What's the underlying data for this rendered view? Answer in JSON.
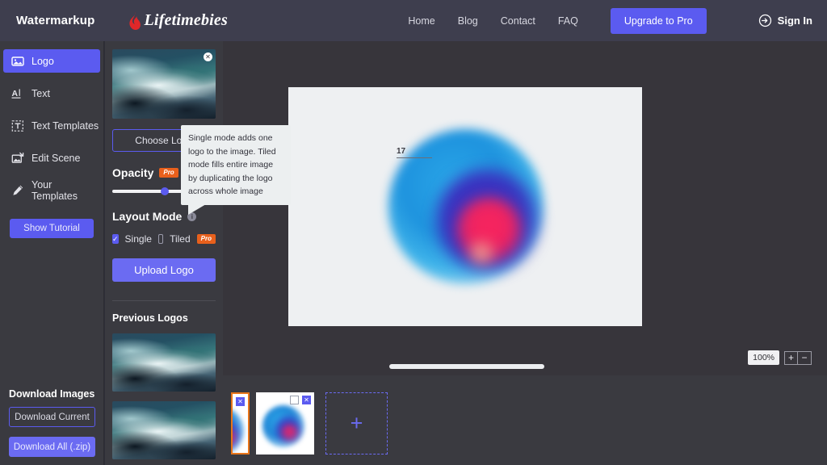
{
  "header": {
    "brand": "Watermarkup",
    "logo_word": "Lifetimebies",
    "logo_icon": "flame-icon",
    "nav": [
      {
        "label": "Home"
      },
      {
        "label": "Blog"
      },
      {
        "label": "Contact"
      },
      {
        "label": "FAQ"
      }
    ],
    "upgrade_label": "Upgrade to Pro",
    "signin_label": "Sign In",
    "signin_icon": "sign-in-arrow-icon",
    "bg_color": "#3e3e4e",
    "accent_color": "#5b5bf0"
  },
  "sidebar": {
    "items": [
      {
        "label": "Logo",
        "icon": "image-logo-icon",
        "active": true
      },
      {
        "label": "Text",
        "icon": "text-a-icon",
        "active": false
      },
      {
        "label": "Text Templates",
        "icon": "text-template-icon",
        "active": false
      },
      {
        "label": "Edit Scene",
        "icon": "edit-scene-icon",
        "active": false
      },
      {
        "label": "Your Templates",
        "icon": "pencil-icon",
        "active": false
      }
    ],
    "tutorial_label": "Show Tutorial",
    "download_title": "Download Images",
    "download_current_label": "Download Current",
    "download_all_label": "Download All (.zip)"
  },
  "panel": {
    "close_icon": "close-icon",
    "choose_logo_label": "Choose Logo",
    "opacity_label": "Opacity",
    "opacity_pro_badge": "Pro",
    "opacity_value": 48,
    "layout_mode_label": "Layout Mode",
    "layout_info_icon": "info-icon",
    "layout_options": [
      {
        "label": "Single",
        "checked": true,
        "pro": false
      },
      {
        "label": "Tiled",
        "checked": false,
        "pro": true,
        "pro_badge": "Pro"
      }
    ],
    "upload_label": "Upload Logo",
    "previous_logos_title": "Previous Logos"
  },
  "tooltip": {
    "text": "Single mode adds one logo to the image. Tiled mode fills entire image by duplicating the logo across whole image"
  },
  "canvas": {
    "watermark_number": "17",
    "zoom_value": "100%",
    "zoom_in_label": "+",
    "zoom_out_label": "−",
    "zoom_in_icon": "plus-icon",
    "zoom_out_icon": "minus-icon",
    "artboard_bg": "#eef0f2"
  },
  "filmstrip": {
    "add_icon": "plus-icon",
    "items": [
      {
        "selected": true,
        "close_icon": "close-icon"
      },
      {
        "selected": false,
        "checkbox_icon": "checkbox-icon",
        "close_icon": "close-icon"
      }
    ]
  }
}
